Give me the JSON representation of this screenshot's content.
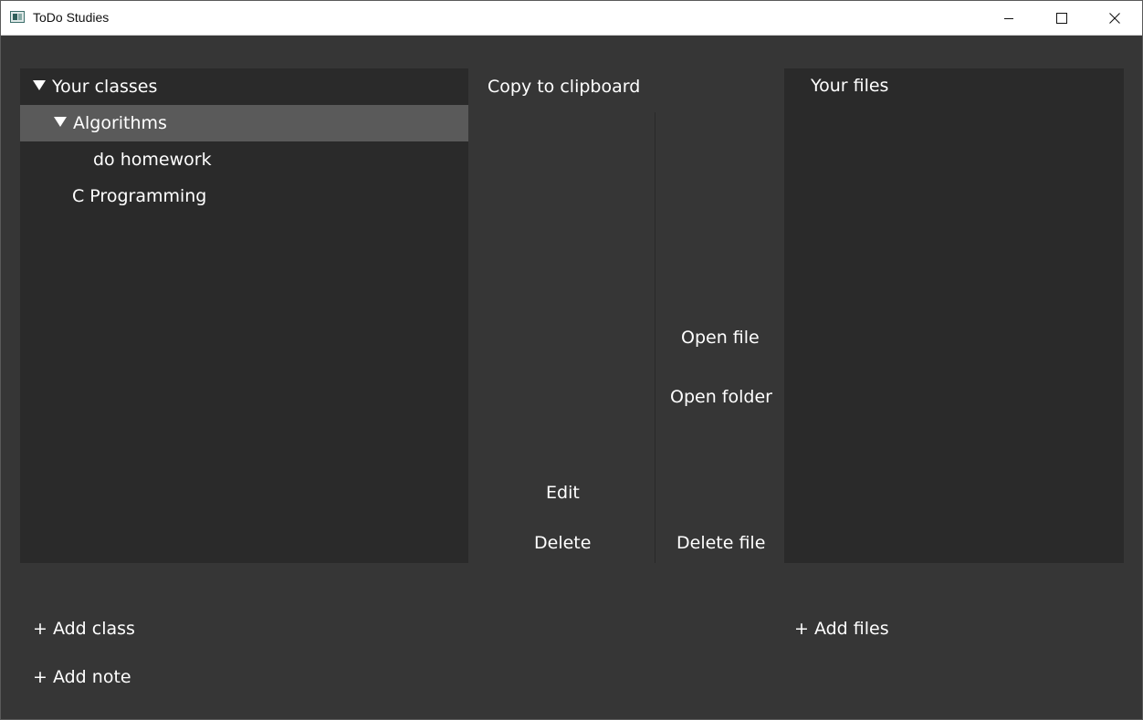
{
  "window": {
    "title": "ToDo Studies"
  },
  "classes_tree": {
    "root_label": "Your classes",
    "items": [
      {
        "label": "Algorithms",
        "expanded": true,
        "selected": true
      },
      {
        "label": "do homework"
      },
      {
        "label": "C Programming"
      }
    ]
  },
  "actions": {
    "copy_to_clipboard": "Copy to clipboard",
    "edit": "Edit",
    "delete": "Delete",
    "open_file": "Open file",
    "open_folder": "Open folder",
    "delete_file": "Delete file"
  },
  "files": {
    "header": "Your files"
  },
  "footer": {
    "add_class": "+ Add class",
    "add_note": "+ Add note",
    "add_files": "+ Add files"
  },
  "colors": {
    "background": "#363636",
    "panel": "#2a2a2a",
    "selected_row": "#5a5a5a",
    "text": "#ffffff"
  },
  "icons": [
    "app-icon",
    "minimize-icon",
    "maximize-icon",
    "close-icon",
    "triangle-down-icon"
  ]
}
